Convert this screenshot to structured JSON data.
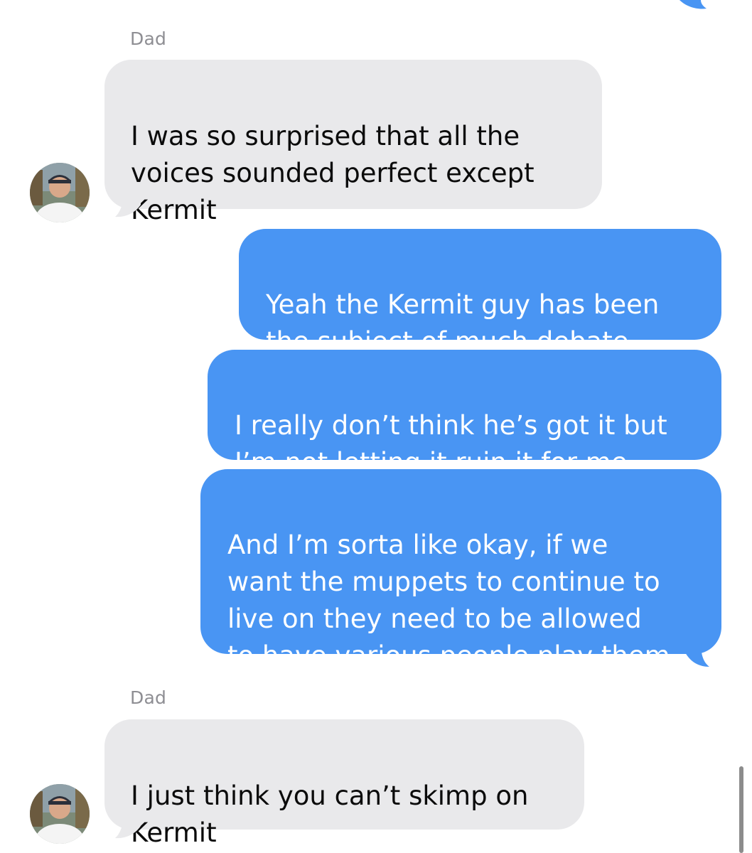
{
  "conversation": {
    "messages": [
      {
        "sender": "Dad",
        "direction": "incoming",
        "text": "I was so surprised that all the\nvoices sounded perfect except\nKermit"
      },
      {
        "direction": "outgoing",
        "text": "Yeah the Kermit guy has been\nthe subject of much debate"
      },
      {
        "direction": "outgoing",
        "text": "I really don’t think he’s got it but\nI’m not letting it ruin it for me"
      },
      {
        "direction": "outgoing",
        "text": "And I’m sorta like okay, if we\nwant the muppets to continue to\nlive on they need to be allowed\nto have various people play them"
      },
      {
        "sender": "Dad",
        "direction": "incoming",
        "text": "I just think you can’t skimp on\nKermit"
      }
    ]
  },
  "colors": {
    "incoming_bubble": "#e9e9eb",
    "outgoing_bubble": "#4995f3",
    "sender_label": "#8e8e93"
  }
}
